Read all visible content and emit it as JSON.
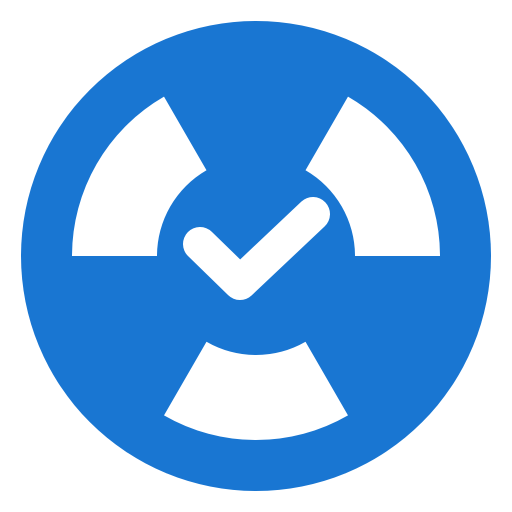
{
  "icon": {
    "name": "radiation-check-icon",
    "colors": {
      "background": "#ffffff",
      "disc": "#1976d2",
      "foreground": "#ffffff"
    }
  }
}
